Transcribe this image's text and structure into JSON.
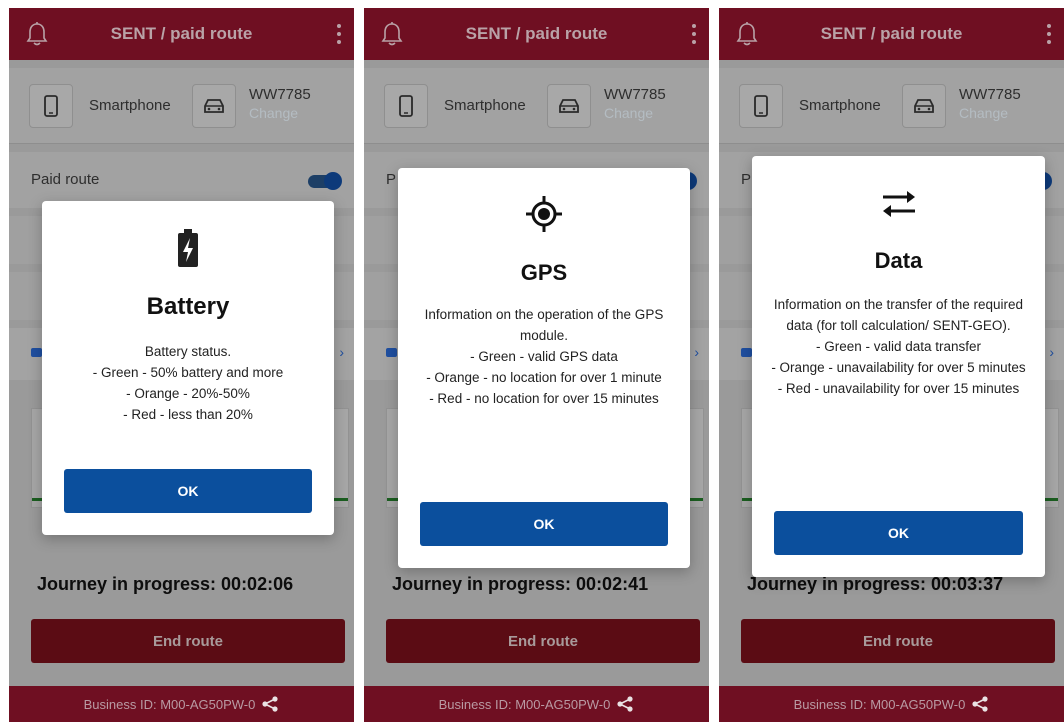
{
  "screens": [
    {
      "app_title": "SENT / paid route",
      "device_label": "Smartphone",
      "plate": "WW7785",
      "change_label": "Change",
      "paid_route_label": "Paid route",
      "paid_route_on": true,
      "journey_text": "Journey in progress: 00:02:06",
      "end_route_label": "End route",
      "footer_text": "Business ID:  M00-AG50PW-0",
      "dialog": {
        "icon": "battery-charging-icon",
        "title": "Battery",
        "lines": [
          "Battery status.",
          "- Green - 50% battery and more",
          "- Orange - 20%-50%",
          "- Red - less than 20%"
        ],
        "ok_label": "OK"
      }
    },
    {
      "app_title": "SENT / paid route",
      "device_label": "Smartphone",
      "plate": "WW7785",
      "change_label": "Change",
      "paid_route_label": "P",
      "paid_route_on": true,
      "journey_text": "Journey in progress: 00:02:41",
      "end_route_label": "End route",
      "footer_text": "Business ID:  M00-AG50PW-0",
      "dialog": {
        "icon": "gps-target-icon",
        "title": "GPS",
        "lines": [
          "Information on the operation of the GPS module.",
          "- Green - valid GPS data",
          "- Orange - no location for over 1 minute",
          "- Red - no location for over 15 minutes"
        ],
        "ok_label": "OK"
      }
    },
    {
      "app_title": "SENT / paid route",
      "device_label": "Smartphone",
      "plate": "WW7785",
      "change_label": "Change",
      "paid_route_label": "P",
      "paid_route_on": true,
      "journey_text": "Journey in progress: 00:03:37",
      "end_route_label": "End route",
      "footer_text": "Business ID:  M00-AG50PW-0",
      "dialog": {
        "icon": "data-transfer-icon",
        "title": "Data",
        "lines": [
          "Information on the transfer of the required data (for toll calculation/ SENT-GEO).",
          "- Green - valid data transfer",
          "- Orange - unavailability for over 5 minutes",
          "- Red - unavailability for over 15 minutes"
        ],
        "ok_label": "OK"
      }
    }
  ],
  "colors": {
    "topbar": "#8b1330",
    "ok_button": "#0b4f9d",
    "end_button": "#7a0f1c",
    "toggle": "#0d3a7a",
    "progress_line": "#1b5e20"
  }
}
